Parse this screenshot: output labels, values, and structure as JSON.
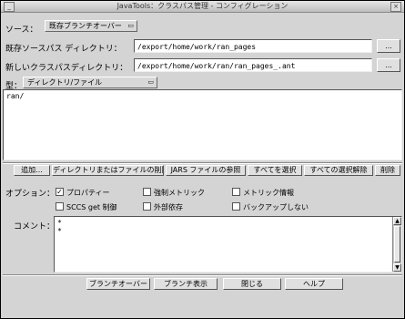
{
  "window": {
    "title": "JavaTools：クラスパス管理 - コンフィグレーション",
    "min_glyph": "_",
    "close_glyph": "×"
  },
  "form": {
    "source_label": "ソース：",
    "source_value": "既存ブランチオーバー",
    "existing_dir_label": "既存ソースパス ディレクトリ：",
    "existing_dir_value": "/export/home/work/ran_pages",
    "new_dir_label": "新しいクラスパスディレクトリ：",
    "new_dir_value": "/export/home/work/ran/ran_pages_.ant",
    "browse_label": "...",
    "type_label": "型：",
    "type_value": "ディレクトリ/ファイル"
  },
  "list": {
    "items": [
      "ran/"
    ]
  },
  "actions": {
    "add": "追加...",
    "remove_dir": "ディレクトリまたはファイルの削除",
    "jar_button": "JARS ファイルの参照",
    "select_all": "すべてを選択",
    "deselect_all": "すべての選択解除",
    "delete": "削除"
  },
  "options": {
    "label": "オプション：",
    "items": [
      {
        "label": "プロパティー",
        "checked": true
      },
      {
        "label": "強制メトリック",
        "checked": false
      },
      {
        "label": "メトリック情報",
        "checked": false
      },
      {
        "label": "SCCS get 制御",
        "checked": false
      },
      {
        "label": "外部依存",
        "checked": false
      },
      {
        "label": "バックアップしない",
        "checked": false
      }
    ]
  },
  "comment": {
    "label": "コメント：",
    "lines": [
      "*",
      "*"
    ]
  },
  "footer": {
    "ok": "ブランチオーバー",
    "display": "ブランチ表示",
    "close": "閉じる",
    "help": "ヘルプ"
  },
  "icons": {
    "dropdown": "chevron-down-icon",
    "scroll_up": "arrow-up-icon",
    "scroll_down": "arrow-down-icon"
  }
}
